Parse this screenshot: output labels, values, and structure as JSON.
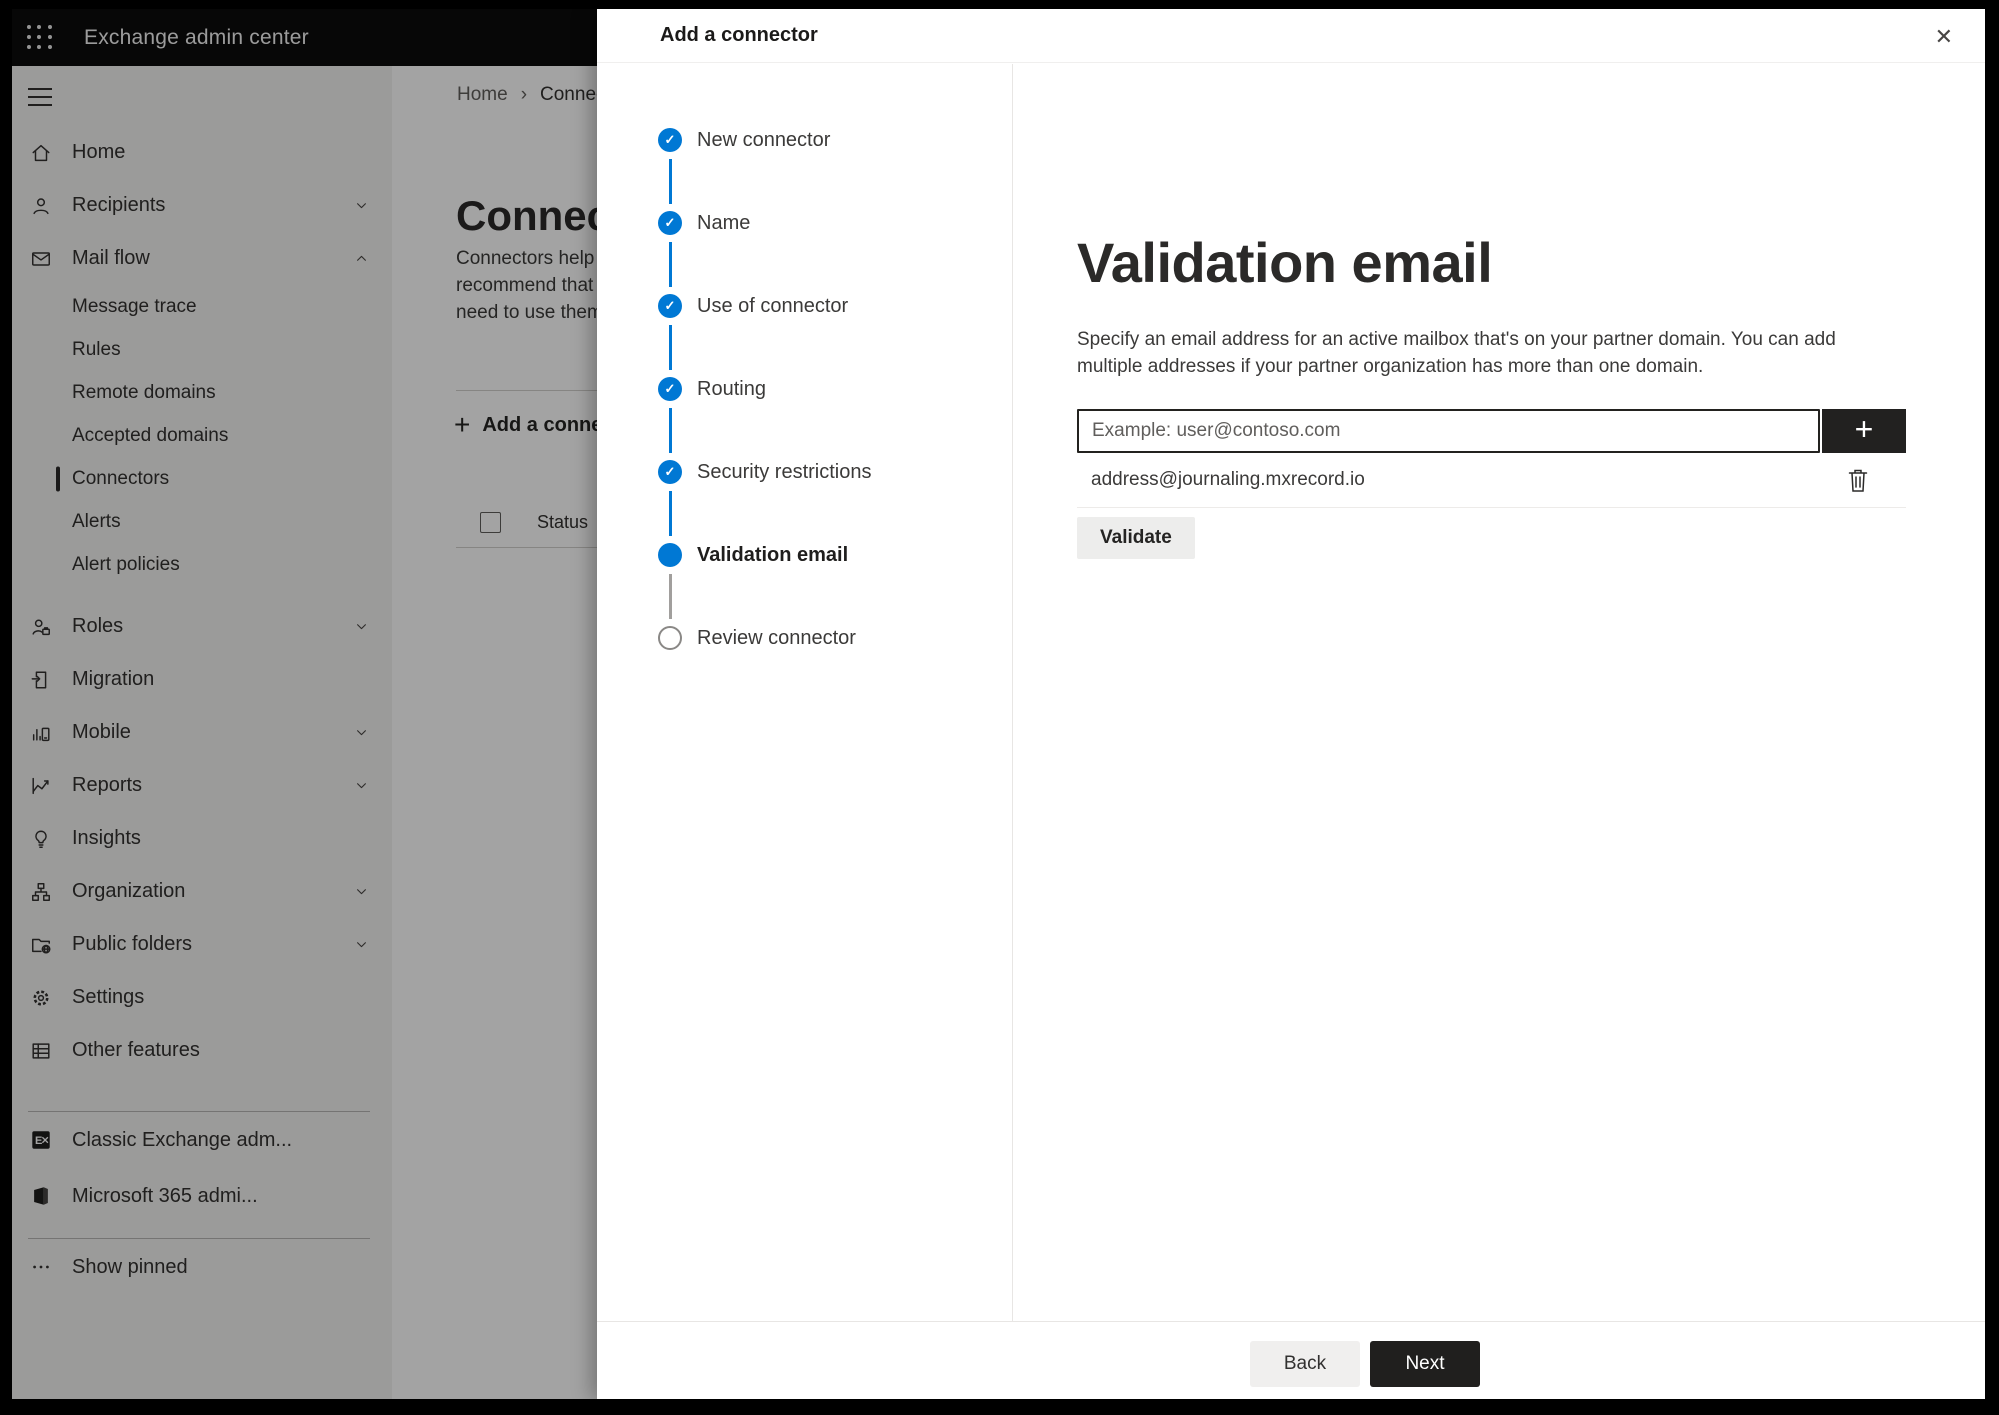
{
  "topbar": {
    "app_title": "Exchange admin center"
  },
  "sidebar": {
    "items": [
      {
        "label": "Home",
        "icon": "home",
        "level": 1
      },
      {
        "label": "Recipients",
        "icon": "person",
        "level": 1,
        "chevron": "down"
      },
      {
        "label": "Mail flow",
        "icon": "mail",
        "level": 1,
        "chevron": "up"
      },
      {
        "label": "Message trace",
        "level": 2
      },
      {
        "label": "Rules",
        "level": 2
      },
      {
        "label": "Remote domains",
        "level": 2
      },
      {
        "label": "Accepted domains",
        "level": 2
      },
      {
        "label": "Connectors",
        "level": 2,
        "selected": true
      },
      {
        "label": "Alerts",
        "level": 2
      },
      {
        "label": "Alert policies",
        "level": 2
      },
      {
        "label": "Roles",
        "icon": "roles",
        "level": 1,
        "chevron": "down"
      },
      {
        "label": "Migration",
        "icon": "migration",
        "level": 1
      },
      {
        "label": "Mobile",
        "icon": "mobile",
        "level": 1,
        "chevron": "down"
      },
      {
        "label": "Reports",
        "icon": "reports",
        "level": 1,
        "chevron": "down"
      },
      {
        "label": "Insights",
        "icon": "insights",
        "level": 1
      },
      {
        "label": "Organization",
        "icon": "organization",
        "level": 1,
        "chevron": "down"
      },
      {
        "label": "Public folders",
        "icon": "public-folders",
        "level": 1,
        "chevron": "down"
      },
      {
        "label": "Settings",
        "icon": "settings",
        "level": 1
      },
      {
        "label": "Other features",
        "icon": "other-features",
        "level": 1
      }
    ],
    "links": [
      {
        "label": "Classic Exchange adm...",
        "icon": "classic-exchange"
      },
      {
        "label": "Microsoft 365 admi...",
        "icon": "m365"
      }
    ],
    "show_pinned": {
      "label": "Show pinned",
      "icon": "dots"
    }
  },
  "page": {
    "breadcrumb": [
      "Home",
      "Connectors"
    ],
    "breadcrumb_separator": "›",
    "title": "Connectors",
    "description_lines": [
      "Connectors help",
      "recommend that",
      "need to use them"
    ],
    "add_button_label": "Add a connector",
    "add_button_plus": "+",
    "table": {
      "status_column": "Status"
    }
  },
  "dialog": {
    "title": "Add a connector",
    "close_glyph": "✕",
    "steps": [
      {
        "label": "New connector",
        "state": "completed"
      },
      {
        "label": "Name",
        "state": "completed"
      },
      {
        "label": "Use of connector",
        "state": "completed"
      },
      {
        "label": "Routing",
        "state": "completed"
      },
      {
        "label": "Security restrictions",
        "state": "completed"
      },
      {
        "label": "Validation email",
        "state": "current"
      },
      {
        "label": "Review connector",
        "state": "upcoming"
      }
    ],
    "check_glyph": "✓",
    "content": {
      "heading": "Validation email",
      "description_lines": [
        "Specify an email address for an active mailbox that's on your partner domain. You can add",
        "multiple addresses if your partner organization has more than one domain."
      ],
      "email_input_placeholder": "Example: user@contoso.com",
      "add_address_glyph": "+",
      "addresses": [
        "address@journaling.mxrecord.io"
      ],
      "validate_label": "Validate"
    },
    "footer": {
      "back_label": "Back",
      "next_label": "Next"
    }
  },
  "colors": {
    "accent": "#0078d4",
    "topbar_bg": "#0c0c0c",
    "next_button_bg": "#201f1e",
    "overlay": "rgba(0,0,0,0.36)",
    "step_pending_line": "#a19f9d"
  }
}
